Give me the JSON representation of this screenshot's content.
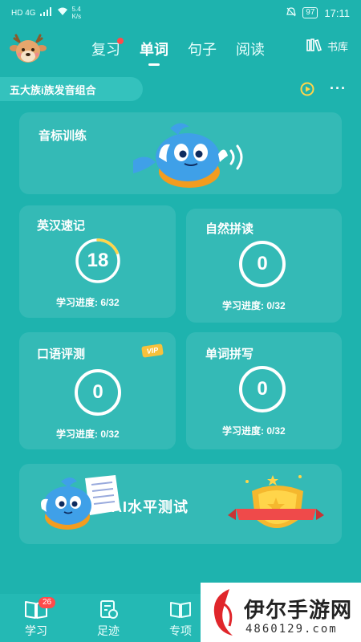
{
  "status": {
    "network": "HD 4G",
    "speed_value": "5.4",
    "speed_unit": "K/s",
    "battery": "97",
    "time": "17:11"
  },
  "topnav": {
    "tabs": [
      {
        "label": "复习",
        "active": false,
        "has_dot": true
      },
      {
        "label": "单词",
        "active": true
      },
      {
        "label": "句子",
        "active": false
      },
      {
        "label": "阅读",
        "active": false
      }
    ],
    "library_label": "书库"
  },
  "bookbar": {
    "title": "五大族i族发音组合",
    "more": "···"
  },
  "cards": {
    "phonetic": {
      "title": "音标训练"
    },
    "memorize": {
      "title": "英汉速记",
      "count": "18",
      "progress": "学习进度: 6/32",
      "fraction": 0.1875
    },
    "phonics": {
      "title": "自然拼读",
      "count": "0",
      "progress": "学习进度: 0/32"
    },
    "speaking": {
      "title": "口语评测",
      "count": "0",
      "progress": "学习进度: 0/32",
      "vip": "VIP"
    },
    "spelling": {
      "title": "单词拼写",
      "count": "0",
      "progress": "学习进度: 0/32"
    },
    "ai_test": {
      "title": "AI水平测试"
    }
  },
  "bottomnav": {
    "items": [
      {
        "label": "学习",
        "badge": "26"
      },
      {
        "label": "足迹"
      },
      {
        "label": "专项"
      }
    ]
  },
  "watermark": {
    "text": "伊尔手游网",
    "url": "4860129.com"
  },
  "colors": {
    "background": "#1eb3ae",
    "card": "rgba(255,255,255,0.10)",
    "accent_yellow": "#ffd54a",
    "badge_red": "#ff4b4b"
  }
}
